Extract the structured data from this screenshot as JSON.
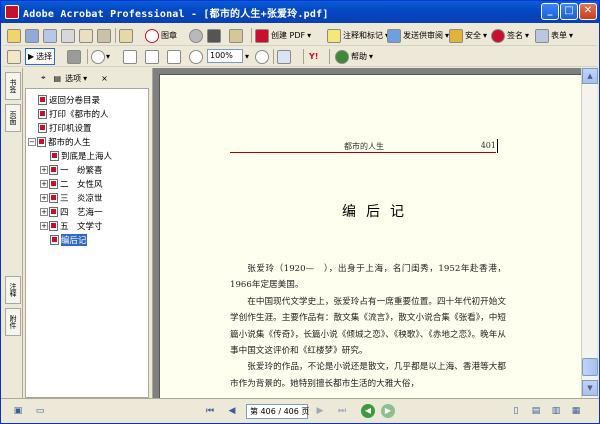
{
  "window": {
    "title": "Adobe Acrobat Professional - [都市的人生+张爱玲.pdf]",
    "min_label": "_",
    "max_label": "□",
    "close_label": "✕"
  },
  "toolbar1": {
    "create_pdf": "创建 PDF",
    "comment": "注释和标记",
    "send_review": "发送供审阅",
    "security": "安全",
    "sign": "签名",
    "forms": "表单",
    "print_label": "图章"
  },
  "toolbar2": {
    "select_label": "选择",
    "zoom_value": "100%",
    "help_label": "帮助"
  },
  "left_panel": {
    "header_options": "选项",
    "close": "×",
    "side_tabs": [
      "书签",
      "页面",
      "注释",
      "附件"
    ],
    "bookmarks": [
      {
        "label": "返回分卷目录",
        "level": 0,
        "expander": ""
      },
      {
        "label": "打印《都市的人",
        "level": 0,
        "expander": ""
      },
      {
        "label": "打印机设置",
        "level": 0,
        "expander": ""
      },
      {
        "label": "都市的人生",
        "level": 0,
        "expander": "−"
      },
      {
        "label": "到底是上海人",
        "level": 1,
        "expander": ""
      },
      {
        "label": "一　纷繁喜",
        "level": 1,
        "expander": "+"
      },
      {
        "label": "二　女性风",
        "level": 1,
        "expander": "+"
      },
      {
        "label": "三　炎凉世",
        "level": 1,
        "expander": "+"
      },
      {
        "label": "四　艺海一",
        "level": 1,
        "expander": "+"
      },
      {
        "label": "五　文学寸",
        "level": 1,
        "expander": "+"
      },
      {
        "label": "编后记",
        "level": 1,
        "expander": "",
        "selected": true
      }
    ]
  },
  "document": {
    "running_head_title": "都市的人生",
    "page_number": "401",
    "chapter_title": "编后记",
    "paragraphs": [
      "张爱玲（1920—　），出身于上海，名门闺秀，1952年赴香港，1966年定居美国。",
      "在中国现代文学史上，张爱玲占有一席重要位置。四十年代初开始文学创作生涯。主要作品有：散文集《流言》，散文小说合集《张看》，中短篇小说集《传奇》，长篇小说《倾城之恋》、《秧歌》、《赤地之恋》。晚年从事中国文这评价和《红楼梦》研究。",
      "张爱玲的作品，不论是小说还是散文，几乎都是以上海、香港等大都市作为背景的。她特别擅长都市生活的大雅大俗，"
    ]
  },
  "statusbar": {
    "page_indicator": "第 406 / 406 页"
  }
}
